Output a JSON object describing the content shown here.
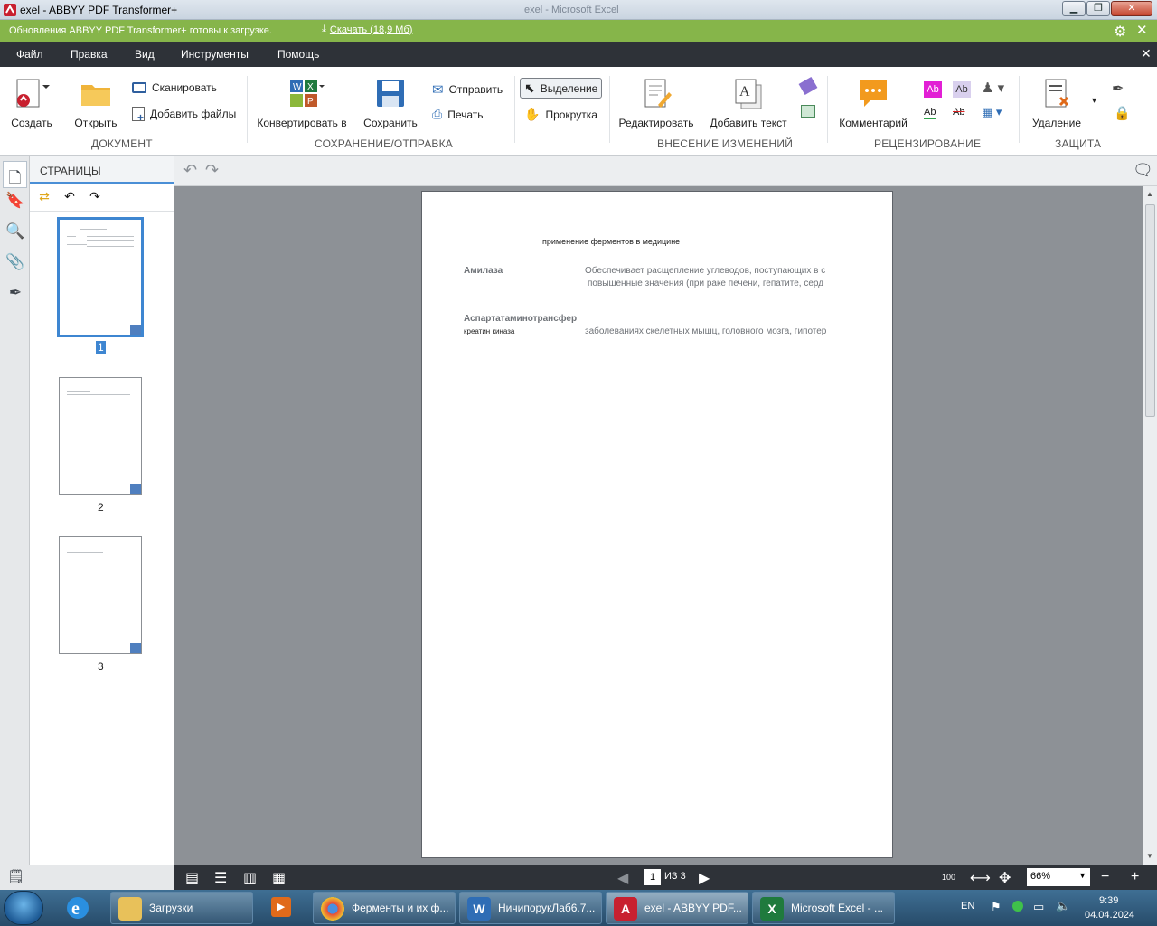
{
  "window": {
    "title": "exel - ABBYY PDF Transformer+",
    "background_title": "exel - Microsoft Excel"
  },
  "update_bar": {
    "message": "Обновления ABBYY PDF Transformer+ готовы к загрузке.",
    "download_label": "Скачать (18,9 Мб)"
  },
  "menu": {
    "items": [
      "Файл",
      "Правка",
      "Вид",
      "Инструменты",
      "Помощь"
    ]
  },
  "ribbon": {
    "document": {
      "title": "ДОКУМЕНТ",
      "create": "Создать",
      "open": "Открыть",
      "scan": "Сканировать",
      "add_files": "Добавить файлы"
    },
    "save_send": {
      "title": "СОХРАНЕНИЕ/ОТПРАВКА",
      "convert": "Конвертировать в",
      "save": "Сохранить",
      "send": "Отправить",
      "print": "Печать"
    },
    "tools": {
      "select": "Выделение",
      "scroll": "Прокрутка"
    },
    "edit": {
      "title": "ВНЕСЕНИЕ ИЗМЕНЕНИЙ",
      "edit": "Редактировать",
      "add_text": "Добавить текст"
    },
    "review": {
      "title": "РЕЦЕНЗИРОВАНИЕ",
      "comment": "Комментарий"
    },
    "protect": {
      "title": "ЗАЩИТА",
      "delete": "Удаление"
    }
  },
  "pages_panel": {
    "title": "СТРАНИЦЫ",
    "pages": [
      "1",
      "2",
      "3"
    ],
    "selected": "1"
  },
  "document": {
    "heading": "применение ферментов в медицине",
    "rows": [
      {
        "name": "Амилаза",
        "text1": "Обеспечивает расщепление углеводов, поступающих в с",
        "text2": "повышенные значения (при раке печени, гепатите, серд"
      },
      {
        "name": "Аспартатаминотрансфер",
        "sub": "креатин киназа",
        "text1": "заболеваниях скелетных мышц, головного мозга, гипотер"
      }
    ]
  },
  "status": {
    "page": "1",
    "of": "ИЗ 3",
    "zoom": "66%"
  },
  "taskbar": {
    "items": [
      {
        "label": "Загрузки",
        "icon": "folder-icon"
      },
      {
        "label": "Ферменты и их ф...",
        "icon": "chrome-icon"
      },
      {
        "label": "НичипорукЛаб6.7...",
        "icon": "word-icon"
      },
      {
        "label": "exel - ABBYY PDF...",
        "icon": "abbyy-icon"
      },
      {
        "label": "Microsoft Excel - ...",
        "icon": "excel-icon"
      }
    ],
    "lang": "EN",
    "time": "9:39",
    "date": "04.04.2024"
  },
  "colors": {
    "update_bar": "#86b54a",
    "menu_bar": "#2e3238",
    "accent": "#3e86d1"
  }
}
